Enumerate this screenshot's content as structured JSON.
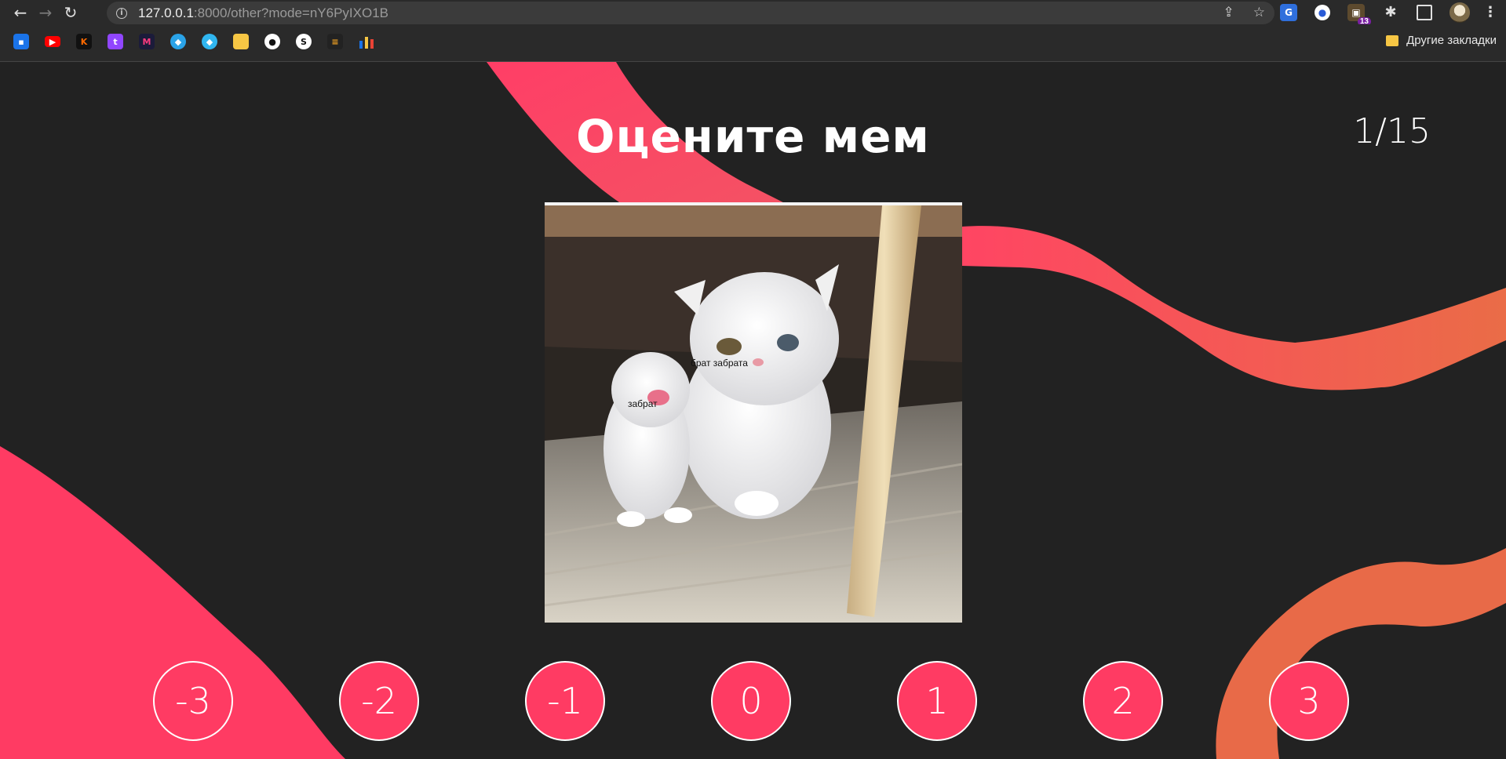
{
  "browser": {
    "url_host": "127.0.0.1",
    "url_rest": ":8000/other?mode=nY6PyIXO1B",
    "extension_badge": "13",
    "other_bookmarks_label": "Другие закладки"
  },
  "page": {
    "title": "Оцените мем",
    "counter": "1/15",
    "meme": {
      "caption_big_cat": "брат забрата",
      "caption_kitten": "забрат"
    },
    "rating_buttons": [
      "-3",
      "-2",
      "-1",
      "0",
      "1",
      "2",
      "3"
    ],
    "colors": {
      "background": "#222222",
      "accent": "#ff3b63",
      "accent_orange": "#e96a4d"
    }
  }
}
